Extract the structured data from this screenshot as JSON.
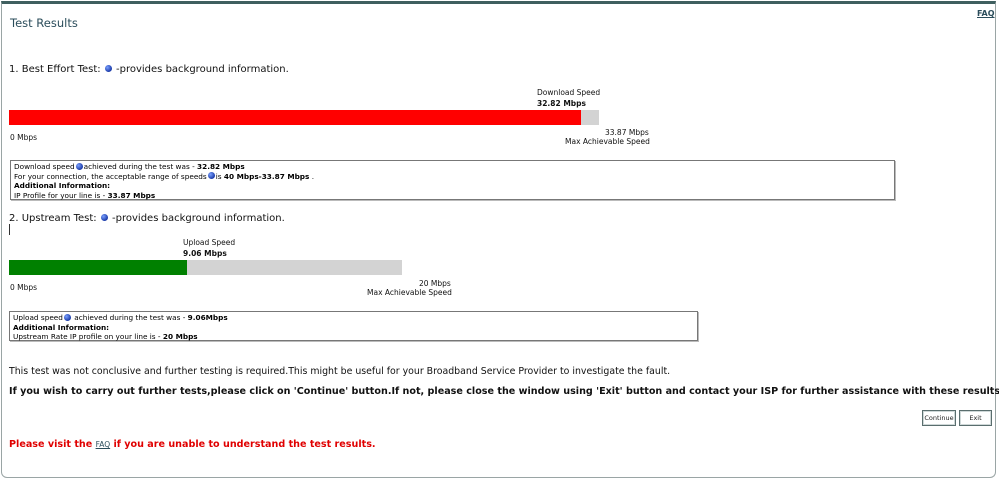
{
  "page": {
    "title": "Test Results",
    "faq_top": "FAQ"
  },
  "best_effort": {
    "heading_prefix": "1. Best Effort Test:",
    "heading_suffix": "-provides background information.",
    "speed_title": "Download Speed",
    "speed_value": "32.82 Mbps",
    "min_label": "0 Mbps",
    "max_value_label": "33.87 Mbps",
    "max_caption": "Max Achievable Speed",
    "fill_fraction": 0.969,
    "fill_color": "#ff0000",
    "track_color": "#d3d3d3",
    "info": {
      "line1_a": "Download speed",
      "line1_b": "achieved during the test was -",
      "line1_value": "32.82 Mbps",
      "line2_a": "For your connection, the acceptable range of speeds",
      "line2_b": "is",
      "line2_value": "40 Mbps-33.87 Mbps",
      "line2_end": ".",
      "additional": "Additional Information:",
      "line4_a": "IP Profile for your line is -",
      "line4_value": "33.87 Mbps"
    }
  },
  "upstream": {
    "heading_prefix": "2. Upstream Test:",
    "heading_suffix": "-provides background information.",
    "speed_title": "Upload Speed",
    "speed_value": "9.06 Mbps",
    "min_label": "0 Mbps",
    "max_value_label": "20 Mbps",
    "max_caption": "Max Achievable Speed",
    "fill_fraction": 0.453,
    "fill_color": "#008000",
    "track_color": "#d3d3d3",
    "info": {
      "line1_a": "Upload speed",
      "line1_b": "achieved during the test was -",
      "line1_value": "9.06Mbps",
      "additional": "Additional Information:",
      "line3_a": "Upstream Rate IP profile on your line is -",
      "line3_value": "20 Mbps"
    }
  },
  "messages": {
    "inconclusive": "This test was not conclusive and further testing is required.This might be useful for your Broadband Service Provider to investigate the fault.",
    "instructions": "If you wish to carry out further tests,please click on 'Continue' button.If not, please close the window using 'Exit' button and contact your ISP for further assistance with these results.",
    "visit_prefix": "Please visit the",
    "visit_link": "FAQ",
    "visit_suffix": "if you are unable to understand the test results."
  },
  "buttons": {
    "continue": "Continue",
    "exit": "Exit"
  }
}
